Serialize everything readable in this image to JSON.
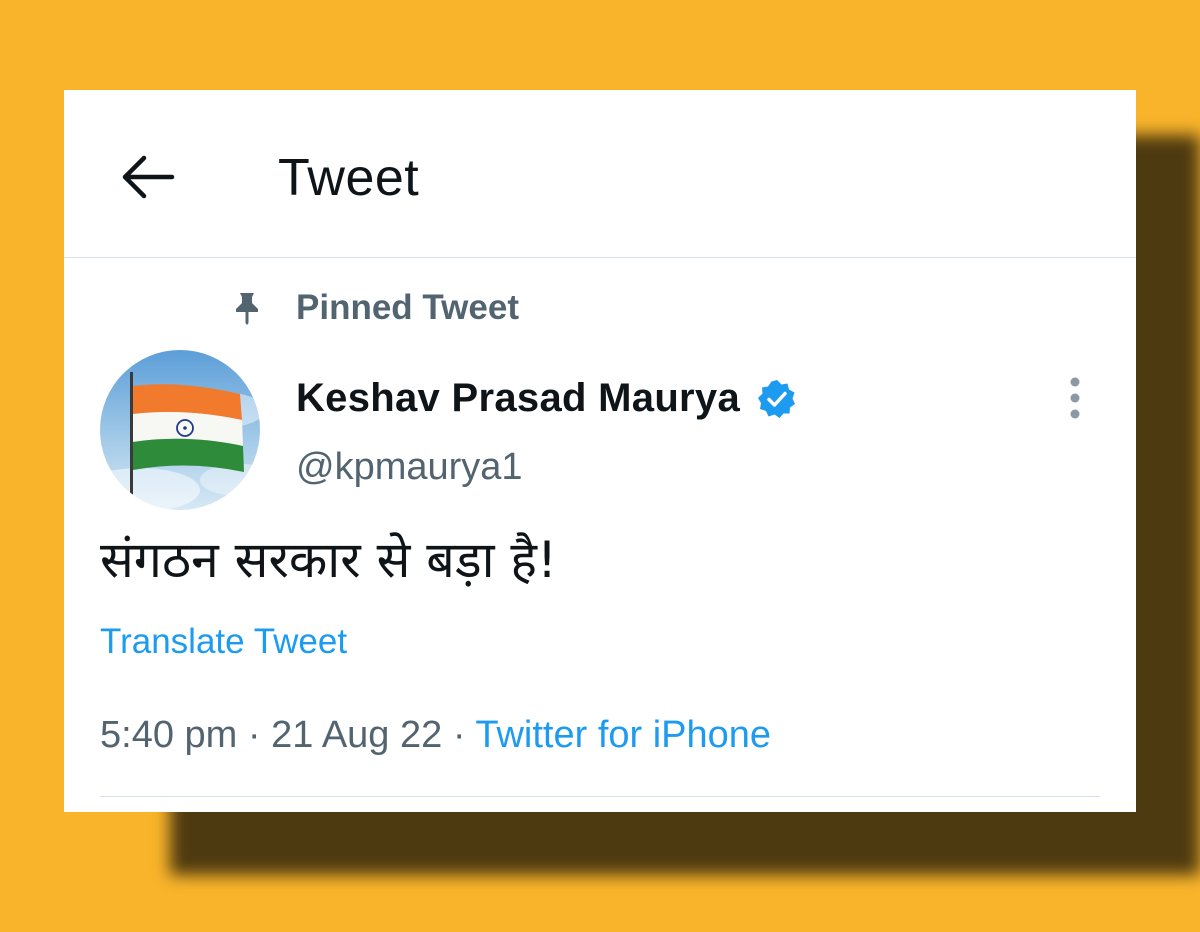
{
  "header": {
    "title": "Tweet",
    "back_icon": "arrow-left-icon"
  },
  "pinned": {
    "label": "Pinned Tweet",
    "icon": "pin-icon"
  },
  "author": {
    "name": "Keshav Prasad Maurya",
    "handle": "@kpmaurya1",
    "verified_icon": "verified-badge-icon",
    "avatar": "indian-flag-avatar"
  },
  "tweet": {
    "text": "संगठन सरकार से बड़ा है!",
    "translate_label": "Translate Tweet"
  },
  "meta": {
    "time": "5:40 pm",
    "separator": "·",
    "date": "21 Aug 22",
    "source": "Twitter for iPhone"
  },
  "colors": {
    "background": "#f9b42b",
    "accent": "#1d9bf0",
    "secondary_text": "#536471",
    "primary_text": "#0f1419"
  }
}
